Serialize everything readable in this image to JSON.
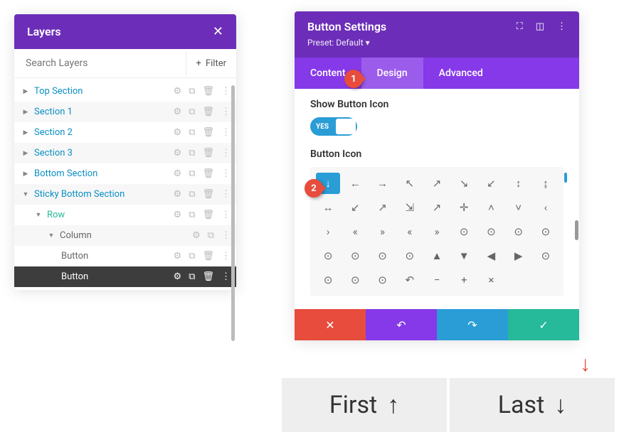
{
  "layers": {
    "title": "Layers",
    "search_placeholder": "Search Layers",
    "filter_label": "Filter",
    "items": [
      {
        "label": "Top Section",
        "type": "section"
      },
      {
        "label": "Section 1",
        "type": "section"
      },
      {
        "label": "Section 2",
        "type": "section"
      },
      {
        "label": "Section 3",
        "type": "section"
      },
      {
        "label": "Bottom Section",
        "type": "section"
      },
      {
        "label": "Sticky Bottom Section",
        "type": "section",
        "expanded": true
      },
      {
        "label": "Row",
        "type": "row",
        "indent": 1,
        "expanded": true
      },
      {
        "label": "Column",
        "type": "column",
        "indent": 2,
        "expanded": true
      },
      {
        "label": "Button",
        "type": "module",
        "indent": 3
      },
      {
        "label": "Button",
        "type": "module",
        "indent": 3,
        "selected": true
      }
    ]
  },
  "settings": {
    "title": "Button Settings",
    "preset": "Preset: Default",
    "tabs": [
      "Content",
      "Design",
      "Advanced"
    ],
    "active_tab": "Design",
    "show_icon_label": "Show Button Icon",
    "toggle_value": "YES",
    "icon_label": "Button Icon",
    "selected_icon": "↓",
    "icons": [
      "↓",
      "←",
      "→",
      "↖",
      "↗",
      "↘",
      "↙",
      "↕",
      "↨",
      "↔",
      "↙",
      "↗",
      "⇲",
      "↗",
      "✛",
      "˄",
      "˅",
      "‹",
      "›",
      "«",
      "»",
      "«",
      "»",
      "⊙",
      "⊙",
      "⊙",
      "⊙",
      "⊙",
      "⊙",
      "⊙",
      "⊙",
      "▲",
      "▼",
      "◀",
      "▶",
      "⊙",
      "⊙",
      "⊙",
      "⊙",
      "↶",
      "−",
      "+",
      "×"
    ]
  },
  "callouts": {
    "one": "1",
    "two": "2"
  },
  "preview": {
    "first": "First",
    "first_icon": "↑",
    "last": "Last",
    "last_icon": "↓"
  }
}
